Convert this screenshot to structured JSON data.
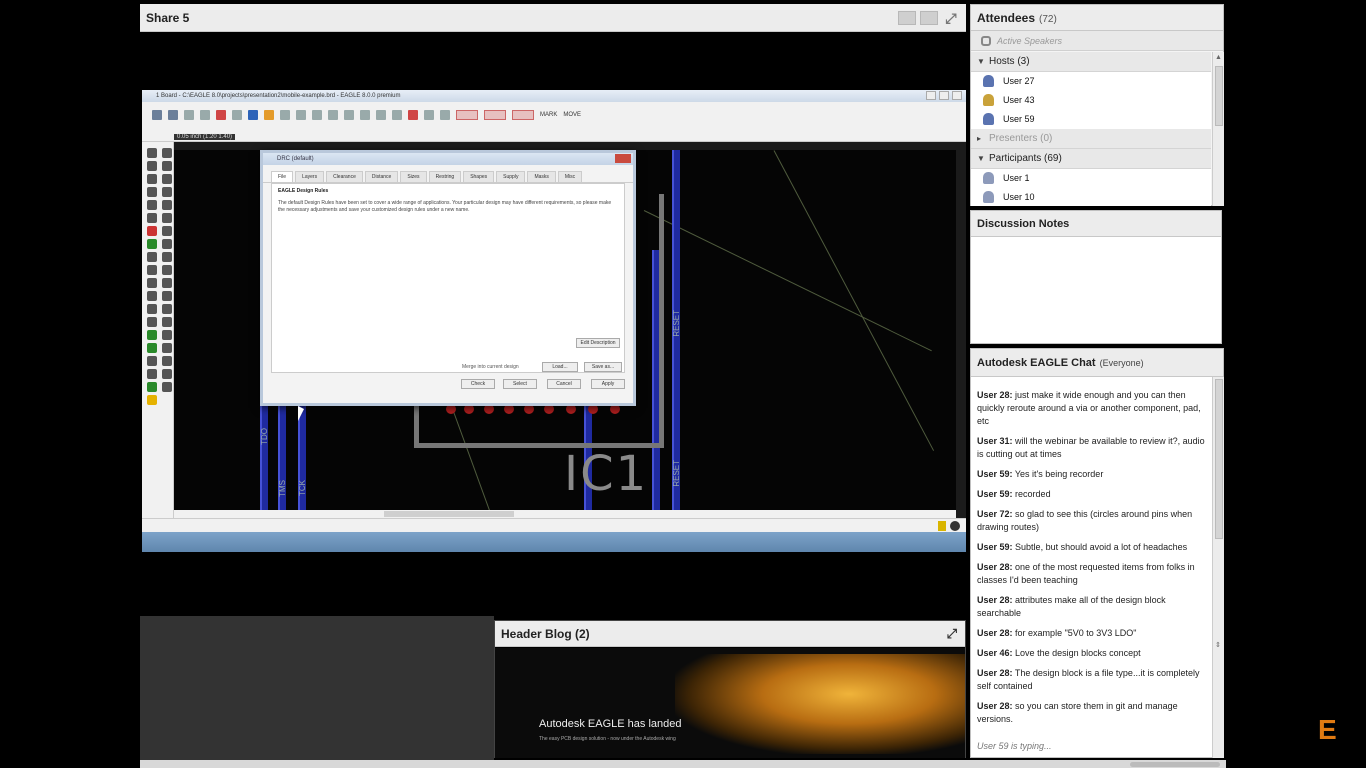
{
  "share_pod": {
    "title": "Share 5",
    "screen": {
      "window_title": "1 Board - C:\\EAGLE 8.0\\projects\\presentation2\\mobile-example.brd - EAGLE 8.0.0 premium",
      "coordinate_readout": "0.05 inch (1.20 1.40)",
      "toolbar_text": [
        "MARK",
        "MOVE"
      ],
      "board": {
        "chip_label": "IC1",
        "pin_labels": [
          "TDO",
          "TMS",
          "TCK",
          "RESET",
          "RESET"
        ]
      },
      "dialog": {
        "title": "DRC (default)",
        "tabs": [
          "File",
          "Layers",
          "Clearance",
          "Distance",
          "Sizes",
          "Restring",
          "Shapes",
          "Supply",
          "Masks",
          "Misc"
        ],
        "active_tab": "File",
        "heading": "EAGLE Design Rules",
        "paragraph": "The default Design Rules have been set to cover a wide range of applications. Your particular design may have different requirements, so please make the necessary adjustments and save your customized design rules under a new name.",
        "edit_description_button": "Edit Description",
        "merge_checkbox": "Merge into current design",
        "load_button": "Load...",
        "save_as_button": "Save as...",
        "check_button": "Check",
        "select_button": "Select",
        "cancel_button": "Cancel",
        "apply_button": "Apply"
      }
    }
  },
  "attendees": {
    "title": "Attendees",
    "count": "(72)",
    "active_speakers": "Active Speakers",
    "hosts_label": "Hosts (3)",
    "hosts": [
      "User 27",
      "User 43",
      "User 59"
    ],
    "presenters_label": "Presenters (0)",
    "participants_label": "Participants (69)",
    "participants": [
      "User 1",
      "User 10"
    ]
  },
  "notes": {
    "title": "Discussion Notes"
  },
  "chat": {
    "title": "Autodesk EAGLE Chat",
    "audience": "(Everyone)",
    "messages": [
      {
        "user": "User 28:",
        "text": "just make it wide enough and you can then quickly reroute around a via or another component, pad, etc"
      },
      {
        "user": "User 31:",
        "text": "will the webinar be available to review it?, audio is cutting out at times"
      },
      {
        "user": "User 59:",
        "text": "Yes it's being recorder"
      },
      {
        "user": "User 59:",
        "text": "recorded"
      },
      {
        "user": "User 72:",
        "text": "so glad to see this (circles around pins when drawing routes)"
      },
      {
        "user": "User 59:",
        "text": "Subtle, but should avoid a lot of headaches"
      },
      {
        "user": "User 28:",
        "text": "one of the most requested items from folks in classes I'd been teaching"
      },
      {
        "user": "User 28:",
        "text": "attributes make all of the design block searchable"
      },
      {
        "user": "User 28:",
        "text": "for example \"5V0 to 3V3 LDO\""
      },
      {
        "user": "User 46:",
        "text": "Love the design blocks concept"
      },
      {
        "user": "User 28:",
        "text": "The design block is a file type...it is completely self contained"
      },
      {
        "user": "User 28:",
        "text": "so you can store them in git and manage versions."
      }
    ],
    "typing": "User 59 is typing..."
  },
  "blog": {
    "title": "Header Blog (2)",
    "headline": "Autodesk EAGLE has landed",
    "subline": "The easy PCB design solution - now under the Autodesk wing"
  },
  "brand": {
    "letter": "E",
    "accent": "#e07a12"
  }
}
